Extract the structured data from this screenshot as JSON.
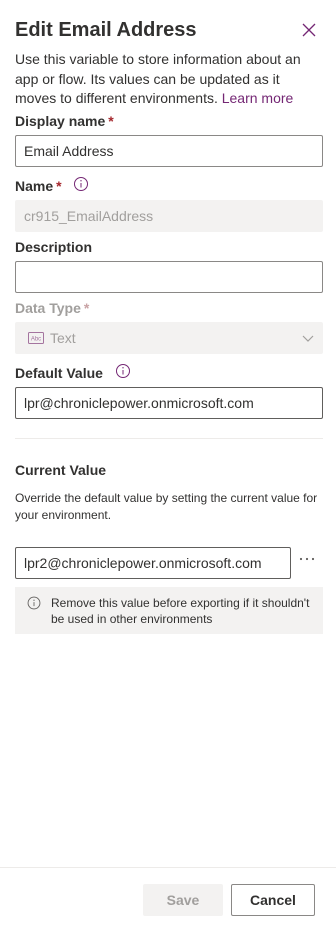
{
  "header": {
    "title": "Edit Email Address",
    "close_icon": "close-icon"
  },
  "intro": {
    "text": "Use this variable to store information about an app or flow. Its values can be updated as it moves to different environments.",
    "link": "Learn more"
  },
  "fields": {
    "display_name": {
      "label": "Display name",
      "required": "*",
      "value": "Email Address"
    },
    "name": {
      "label": "Name",
      "required": "*",
      "value": "cr915_EmailAddress"
    },
    "description": {
      "label": "Description",
      "value": ""
    },
    "data_type": {
      "label": "Data Type",
      "required": "*",
      "value": "Text"
    },
    "default_value": {
      "label": "Default Value",
      "value": "lpr@chroniclepower.onmicrosoft.com"
    }
  },
  "current_value": {
    "title": "Current Value",
    "help": "Override the default value by setting the current value for your environment.",
    "value": "lpr2@chroniclepower.onmicrosoft.com",
    "more_icon": "ellipsis-icon",
    "message": "Remove this value before exporting if it shouldn't be used in other environments"
  },
  "footer": {
    "save": "Save",
    "cancel": "Cancel"
  },
  "colors": {
    "link": "#742774",
    "required": "#a4262c",
    "disabled_bg": "#f3f2f1"
  }
}
